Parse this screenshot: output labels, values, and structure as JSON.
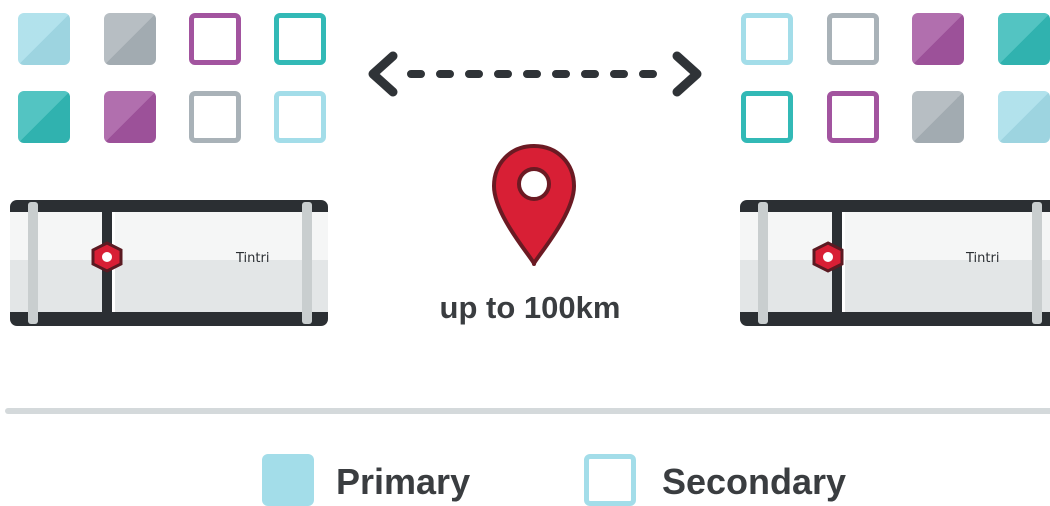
{
  "colors": {
    "cyan": "#a3dde9",
    "gray": "#a9b2b8",
    "purple": "#a2549f",
    "teal": "#32b9b6",
    "pin": "#d81f35",
    "text": "#3a3d40"
  },
  "left_grid": [
    {
      "color": "cyan",
      "style": "filled"
    },
    {
      "color": "gray",
      "style": "filled"
    },
    {
      "color": "purple",
      "style": "outline"
    },
    {
      "color": "teal",
      "style": "outline"
    },
    {
      "color": "teal",
      "style": "filled"
    },
    {
      "color": "purple",
      "style": "filled"
    },
    {
      "color": "gray",
      "style": "outline"
    },
    {
      "color": "cyan",
      "style": "outline"
    }
  ],
  "right_grid": [
    {
      "color": "cyan",
      "style": "outline"
    },
    {
      "color": "gray",
      "style": "outline"
    },
    {
      "color": "purple",
      "style": "filled"
    },
    {
      "color": "teal",
      "style": "filled"
    },
    {
      "color": "teal",
      "style": "outline"
    },
    {
      "color": "purple",
      "style": "outline"
    },
    {
      "color": "gray",
      "style": "filled"
    },
    {
      "color": "cyan",
      "style": "filled"
    }
  ],
  "distance_label": "up to 100km",
  "appliances": {
    "left": {
      "brand": "Tintri"
    },
    "right": {
      "brand": "Tintri"
    }
  },
  "legend": {
    "primary_label": "Primary",
    "secondary_label": "Secondary"
  },
  "icons": {
    "connection": "double-arrow-dashed-icon",
    "location": "map-pin-icon",
    "appliance_logo": "tintri-logo-icon"
  }
}
